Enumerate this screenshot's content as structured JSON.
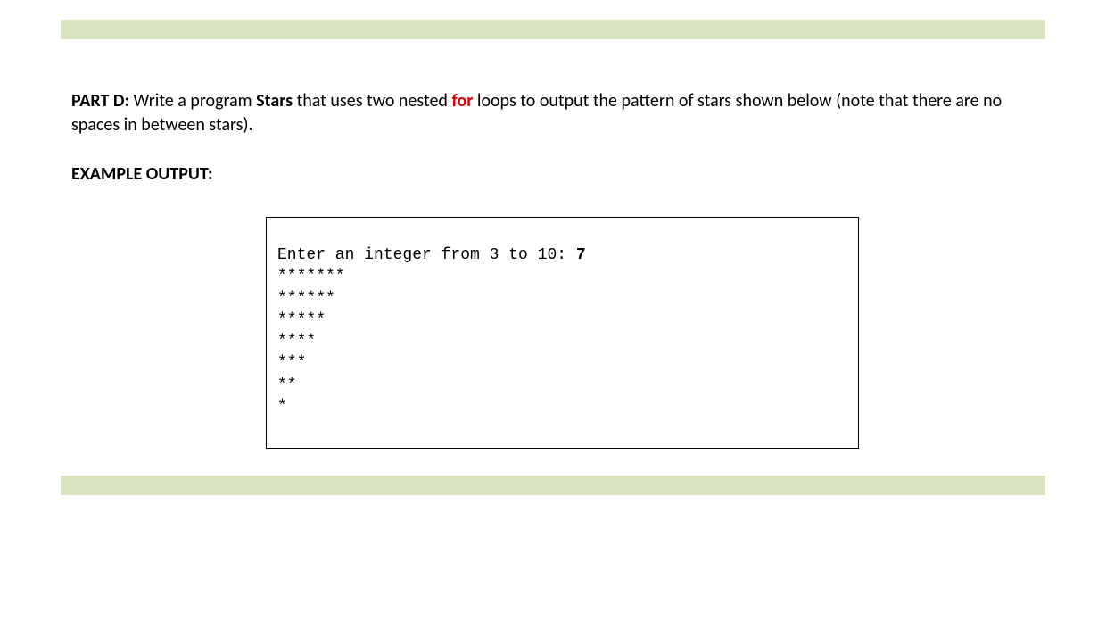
{
  "colors": {
    "accent_bar": "#d8e3bf",
    "keyword": "#d90000"
  },
  "instruction": {
    "part_label": "PART D:",
    "segments": {
      "s1": " Write a program ",
      "program_name": "Stars",
      "s2": " that uses two nested ",
      "for_kw": "for",
      "s3": " loops to output the pattern of stars shown below (note that there are no spaces in between stars)."
    }
  },
  "example_label": "EXAMPLE OUTPUT:",
  "output": {
    "prompt": "Enter an integer from 3 to 10: ",
    "input": "7",
    "lines": [
      "*******",
      "******",
      "*****",
      "****",
      "***",
      "**",
      "*"
    ]
  }
}
